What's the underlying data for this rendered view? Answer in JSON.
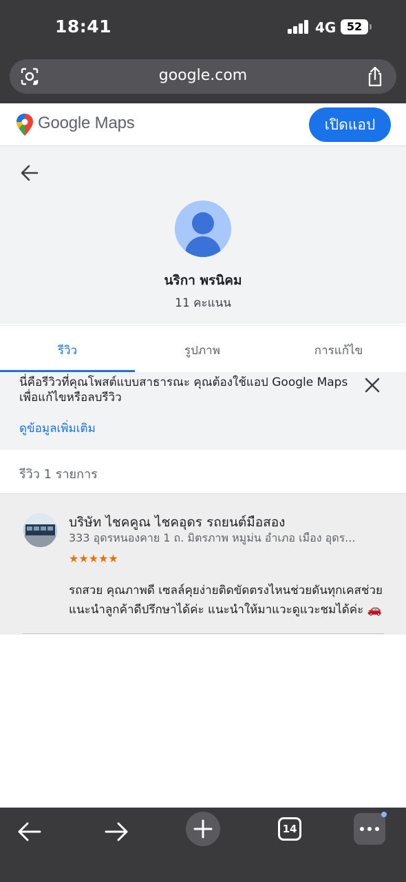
{
  "status_bar": {
    "time": "18:41",
    "network": "4G",
    "battery": "52"
  },
  "browser": {
    "url": "google.com",
    "tab_count": "14",
    "icons": [
      "lens-icon",
      "share-icon",
      "back-arrow-icon",
      "forward-arrow-icon",
      "plus-icon",
      "tabs-icon",
      "more-icon"
    ]
  },
  "header": {
    "logo": "Google Maps",
    "open_app": "เปิดแอป"
  },
  "profile": {
    "name": "นริกา พรนิคม",
    "points": "11 คะแนน"
  },
  "tabs": [
    {
      "label": "รีวิว",
      "active": true
    },
    {
      "label": "รูปภาพ",
      "active": false
    },
    {
      "label": "การแก้ไข",
      "active": false
    }
  ],
  "banner": {
    "text": "นี่คือรีวิวที่คุณโพสต์แบบสาธารณะ คุณต้องใช้แอป Google Maps เพื่อแก้ไขหรือลบรีวิว",
    "link": "ดูข้อมูลเพิ่มเติม"
  },
  "review_count": "รีวิว 1 รายการ",
  "review": {
    "place_name": "บริษัท ไชคคูณ ไชคอุดร รถยนต์มือสอง",
    "address": "333 อุดรหนองคาย 1 ถ. มิตรภาพ หมูม่น อำเภอ เมือง อุดร...",
    "stars": "★★★★★",
    "rating": 5,
    "text": "รถสวย คุณภาพดี เซลล์คุยง่ายติดขัดตรงไหนช่วยดันทุกเคสช่วยแนะนำลูกค้าดีปรึกษาได้ค่ะ แนะนำให้มาแวะดูแวะชมได้ค่ะ 🚗"
  },
  "colors": {
    "accent": "#1a73e8",
    "star": "#e8710a",
    "chrome": "#3a3a3c"
  }
}
